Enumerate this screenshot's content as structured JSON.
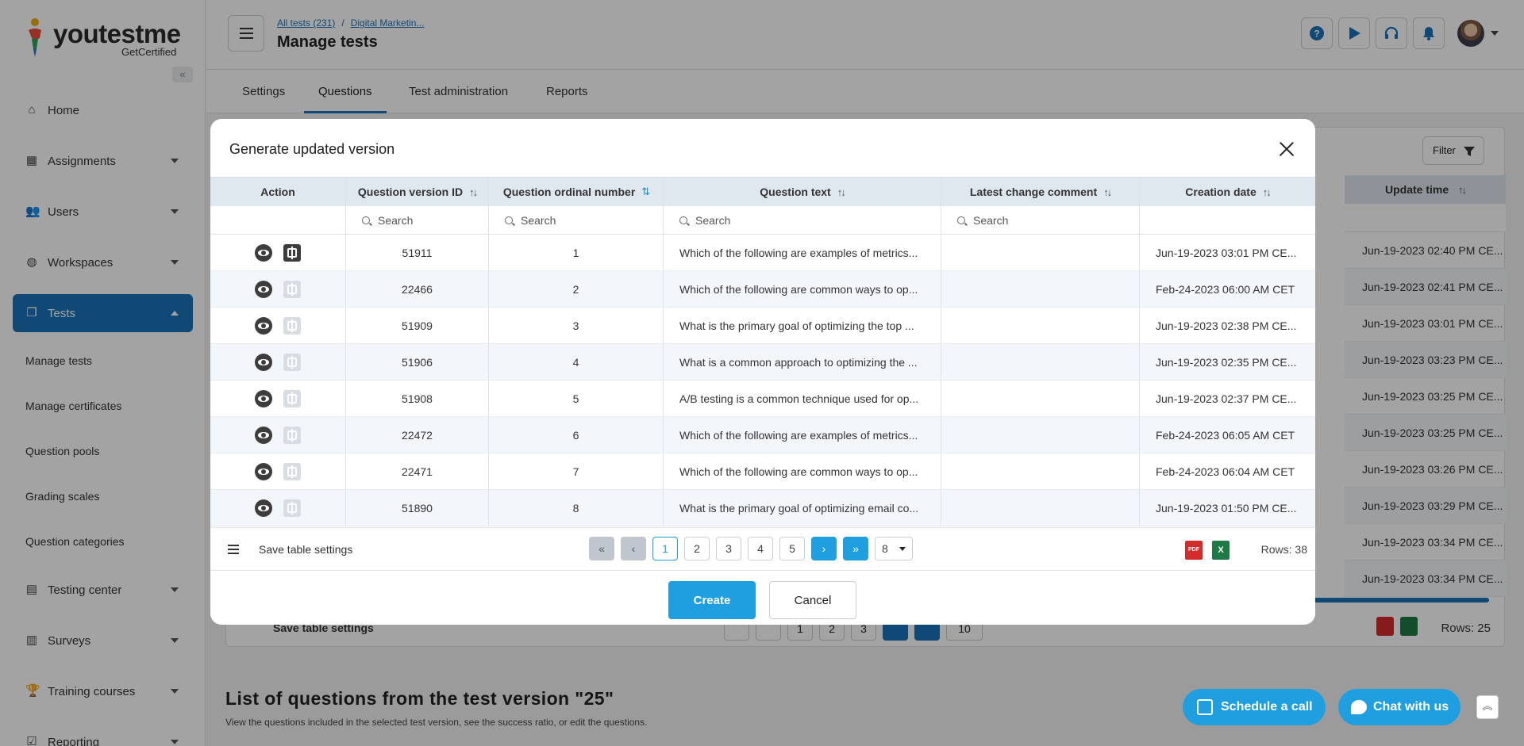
{
  "brand": {
    "name": "youtestme",
    "sub": "GetCertified"
  },
  "sidebar": {
    "items": [
      {
        "label": "Home",
        "icon": "home-icon"
      },
      {
        "label": "Assignments",
        "icon": "assignments-icon"
      },
      {
        "label": "Users",
        "icon": "users-icon"
      },
      {
        "label": "Workspaces",
        "icon": "globe-icon"
      },
      {
        "label": "Tests",
        "icon": "tests-icon"
      },
      {
        "label": "Testing center",
        "icon": "testing-center-icon"
      },
      {
        "label": "Surveys",
        "icon": "surveys-icon"
      },
      {
        "label": "Training courses",
        "icon": "trophy-icon"
      },
      {
        "label": "Reporting",
        "icon": "reporting-icon"
      }
    ],
    "sub_items": [
      "Manage tests",
      "Manage certificates",
      "Question pools",
      "Grading scales",
      "Question categories"
    ]
  },
  "header": {
    "crumb1": "All tests (231)",
    "crumb_sep": "/",
    "crumb2": "Digital Marketin...",
    "title": "Manage tests"
  },
  "tabs": [
    "Settings",
    "Questions",
    "Test administration",
    "Reports"
  ],
  "background": {
    "filter_label": "Filter",
    "update_time_header": "Update time",
    "update_times": [
      "Jun-19-2023 02:40 PM CE...",
      "Jun-19-2023 02:41 PM CE...",
      "Jun-19-2023 03:01 PM CE...",
      "Jun-19-2023 03:23 PM CE...",
      "Jun-19-2023 03:25 PM CE...",
      "Jun-19-2023 03:25 PM CE...",
      "Jun-19-2023 03:26 PM CE...",
      "Jun-19-2023 03:29 PM CE...",
      "Jun-19-2023 03:34 PM CE...",
      "Jun-19-2023 03:34 PM CE..."
    ],
    "save_label": "Save table settings",
    "rows_label": "Rows: 25",
    "page1": "1",
    "page2": "2",
    "page3": "3",
    "page_size": "10",
    "section_title": "List of questions from the test version \"25\"",
    "section_sub": "View the questions included in the selected test version, see the success ratio, or edit the questions."
  },
  "floating": {
    "schedule": "Schedule a call",
    "chat": "Chat with us"
  },
  "modal": {
    "title": "Generate updated version",
    "columns": {
      "action": "Action",
      "version_id": "Question version ID",
      "ordinal": "Question ordinal number",
      "text": "Question text",
      "comment": "Latest change comment",
      "created": "Creation date"
    },
    "search_placeholder": "Search",
    "rows": [
      {
        "id": "51911",
        "ord": "1",
        "text": "Which of the following are examples of metrics...",
        "comment": "",
        "created": "Jun-19-2023 03:01 PM CE..."
      },
      {
        "id": "22466",
        "ord": "2",
        "text": "Which of the following are common ways to op...",
        "comment": "",
        "created": "Feb-24-2023 06:00 AM CET"
      },
      {
        "id": "51909",
        "ord": "3",
        "text": "What is the primary goal of optimizing the top ...",
        "comment": "",
        "created": "Jun-19-2023 02:38 PM CE..."
      },
      {
        "id": "51906",
        "ord": "4",
        "text": "What is a common approach to optimizing the ...",
        "comment": "",
        "created": "Jun-19-2023 02:35 PM CE..."
      },
      {
        "id": "51908",
        "ord": "5",
        "text": "A/B testing is a common technique used for op...",
        "comment": "",
        "created": "Jun-19-2023 02:37 PM CE..."
      },
      {
        "id": "22472",
        "ord": "6",
        "text": "Which of the following are examples of metrics...",
        "comment": "",
        "created": "Feb-24-2023 06:05 AM CET"
      },
      {
        "id": "22471",
        "ord": "7",
        "text": "Which of the following are common ways to op...",
        "comment": "",
        "created": "Feb-24-2023 06:04 AM CET"
      },
      {
        "id": "51890",
        "ord": "8",
        "text": "What is the primary goal of optimizing email co...",
        "comment": "",
        "created": "Jun-19-2023 01:50 PM CE..."
      }
    ],
    "footer": {
      "save_label": "Save table settings",
      "pages": [
        "1",
        "2",
        "3",
        "4",
        "5"
      ],
      "page_size": "8",
      "rows_label": "Rows: 38",
      "pdf_label": "PDF",
      "xls_label": "X"
    },
    "create_label": "Create",
    "cancel_label": "Cancel"
  },
  "colors": {
    "accent": "#1f9fdf",
    "brand_blue": "#1a73b8"
  }
}
